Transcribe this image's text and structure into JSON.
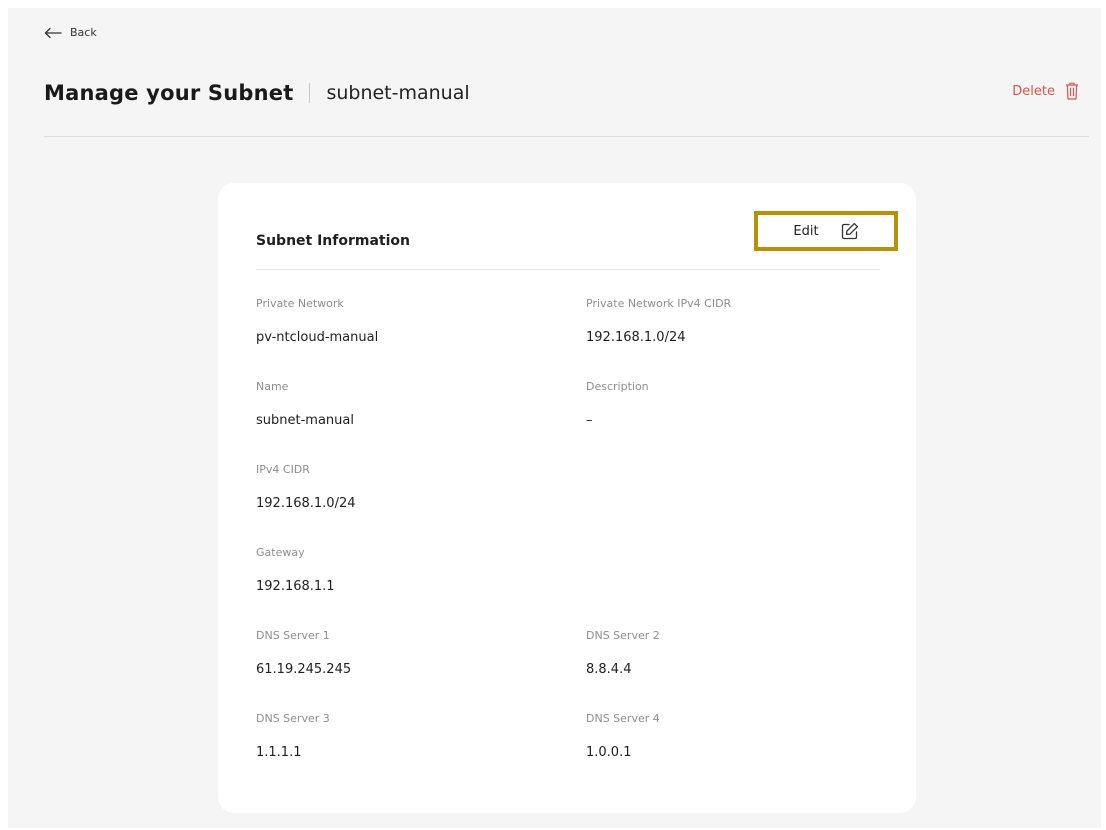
{
  "nav": {
    "back_label": "Back"
  },
  "header": {
    "title": "Manage your Subnet",
    "resource_name": "subnet-manual",
    "delete_label": "Delete"
  },
  "card": {
    "title": "Subnet Information",
    "edit_label": "Edit",
    "fields": {
      "private_network": {
        "label": "Private Network",
        "value": "pv-ntcloud-manual"
      },
      "private_network_cidr": {
        "label": "Private Network IPv4 CIDR",
        "value": "192.168.1.0/24"
      },
      "name": {
        "label": "Name",
        "value": "subnet-manual"
      },
      "description": {
        "label": "Description",
        "value": "–"
      },
      "ipv4_cidr": {
        "label": "IPv4 CIDR",
        "value": "192.168.1.0/24"
      },
      "gateway": {
        "label": "Gateway",
        "value": "192.168.1.1"
      },
      "dns1": {
        "label": "DNS Server 1",
        "value": "61.19.245.245"
      },
      "dns2": {
        "label": "DNS Server 2",
        "value": "8.8.4.4"
      },
      "dns3": {
        "label": "DNS Server 3",
        "value": "1.1.1.1"
      },
      "dns4": {
        "label": "DNS Server 4",
        "value": "1.0.0.1"
      }
    }
  },
  "colors": {
    "accent_highlight": "#b8900a",
    "danger": "#d9534f",
    "background": "#f5f5f5",
    "card": "#ffffff"
  },
  "icons": {
    "back": "arrow-left-icon",
    "delete": "trash-icon",
    "edit": "pencil-square-icon"
  }
}
